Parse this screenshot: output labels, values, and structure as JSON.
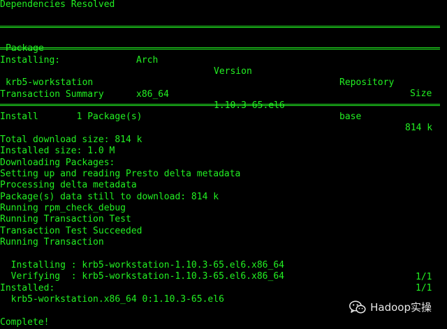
{
  "terminal": {
    "heading": "Dependencies Resolved",
    "table": {
      "headers": [
        "Package",
        "Arch",
        "Version",
        "Repository",
        "Size"
      ],
      "section": "Installing:",
      "rows": [
        [
          "krb5-workstation",
          "x86_64",
          "1.10.3-65.el6",
          "base",
          "814 k"
        ]
      ]
    },
    "summary_title": "Transaction Summary",
    "install_summary": "Install       1 Package(s)",
    "output_lines": [
      "Total download size: 814 k",
      "Installed size: 1.0 M",
      "Downloading Packages:",
      "Setting up and reading Presto delta metadata",
      "Processing delta metadata",
      "Package(s) data still to download: 814 k",
      "Running rpm_check_debug",
      "Running Transaction Test",
      "Transaction Test Succeeded",
      "Running Transaction"
    ],
    "progress_lines": [
      {
        "text": "  Installing : krb5-workstation-1.10.3-65.el6.x86_64",
        "count": "1/1"
      },
      {
        "text": "  Verifying  : krb5-workstation-1.10.3-65.el6.x86_64",
        "count": "1/1"
      }
    ],
    "installed_title": "Installed:",
    "installed_item": "  krb5-workstation.x86_64 0:1.10.3-65.el6",
    "complete": "Complete!",
    "text_color": "#22f022",
    "background_color": "#000000"
  },
  "watermark": {
    "icon": "wechat-icon",
    "text": "Hadoop实操"
  }
}
